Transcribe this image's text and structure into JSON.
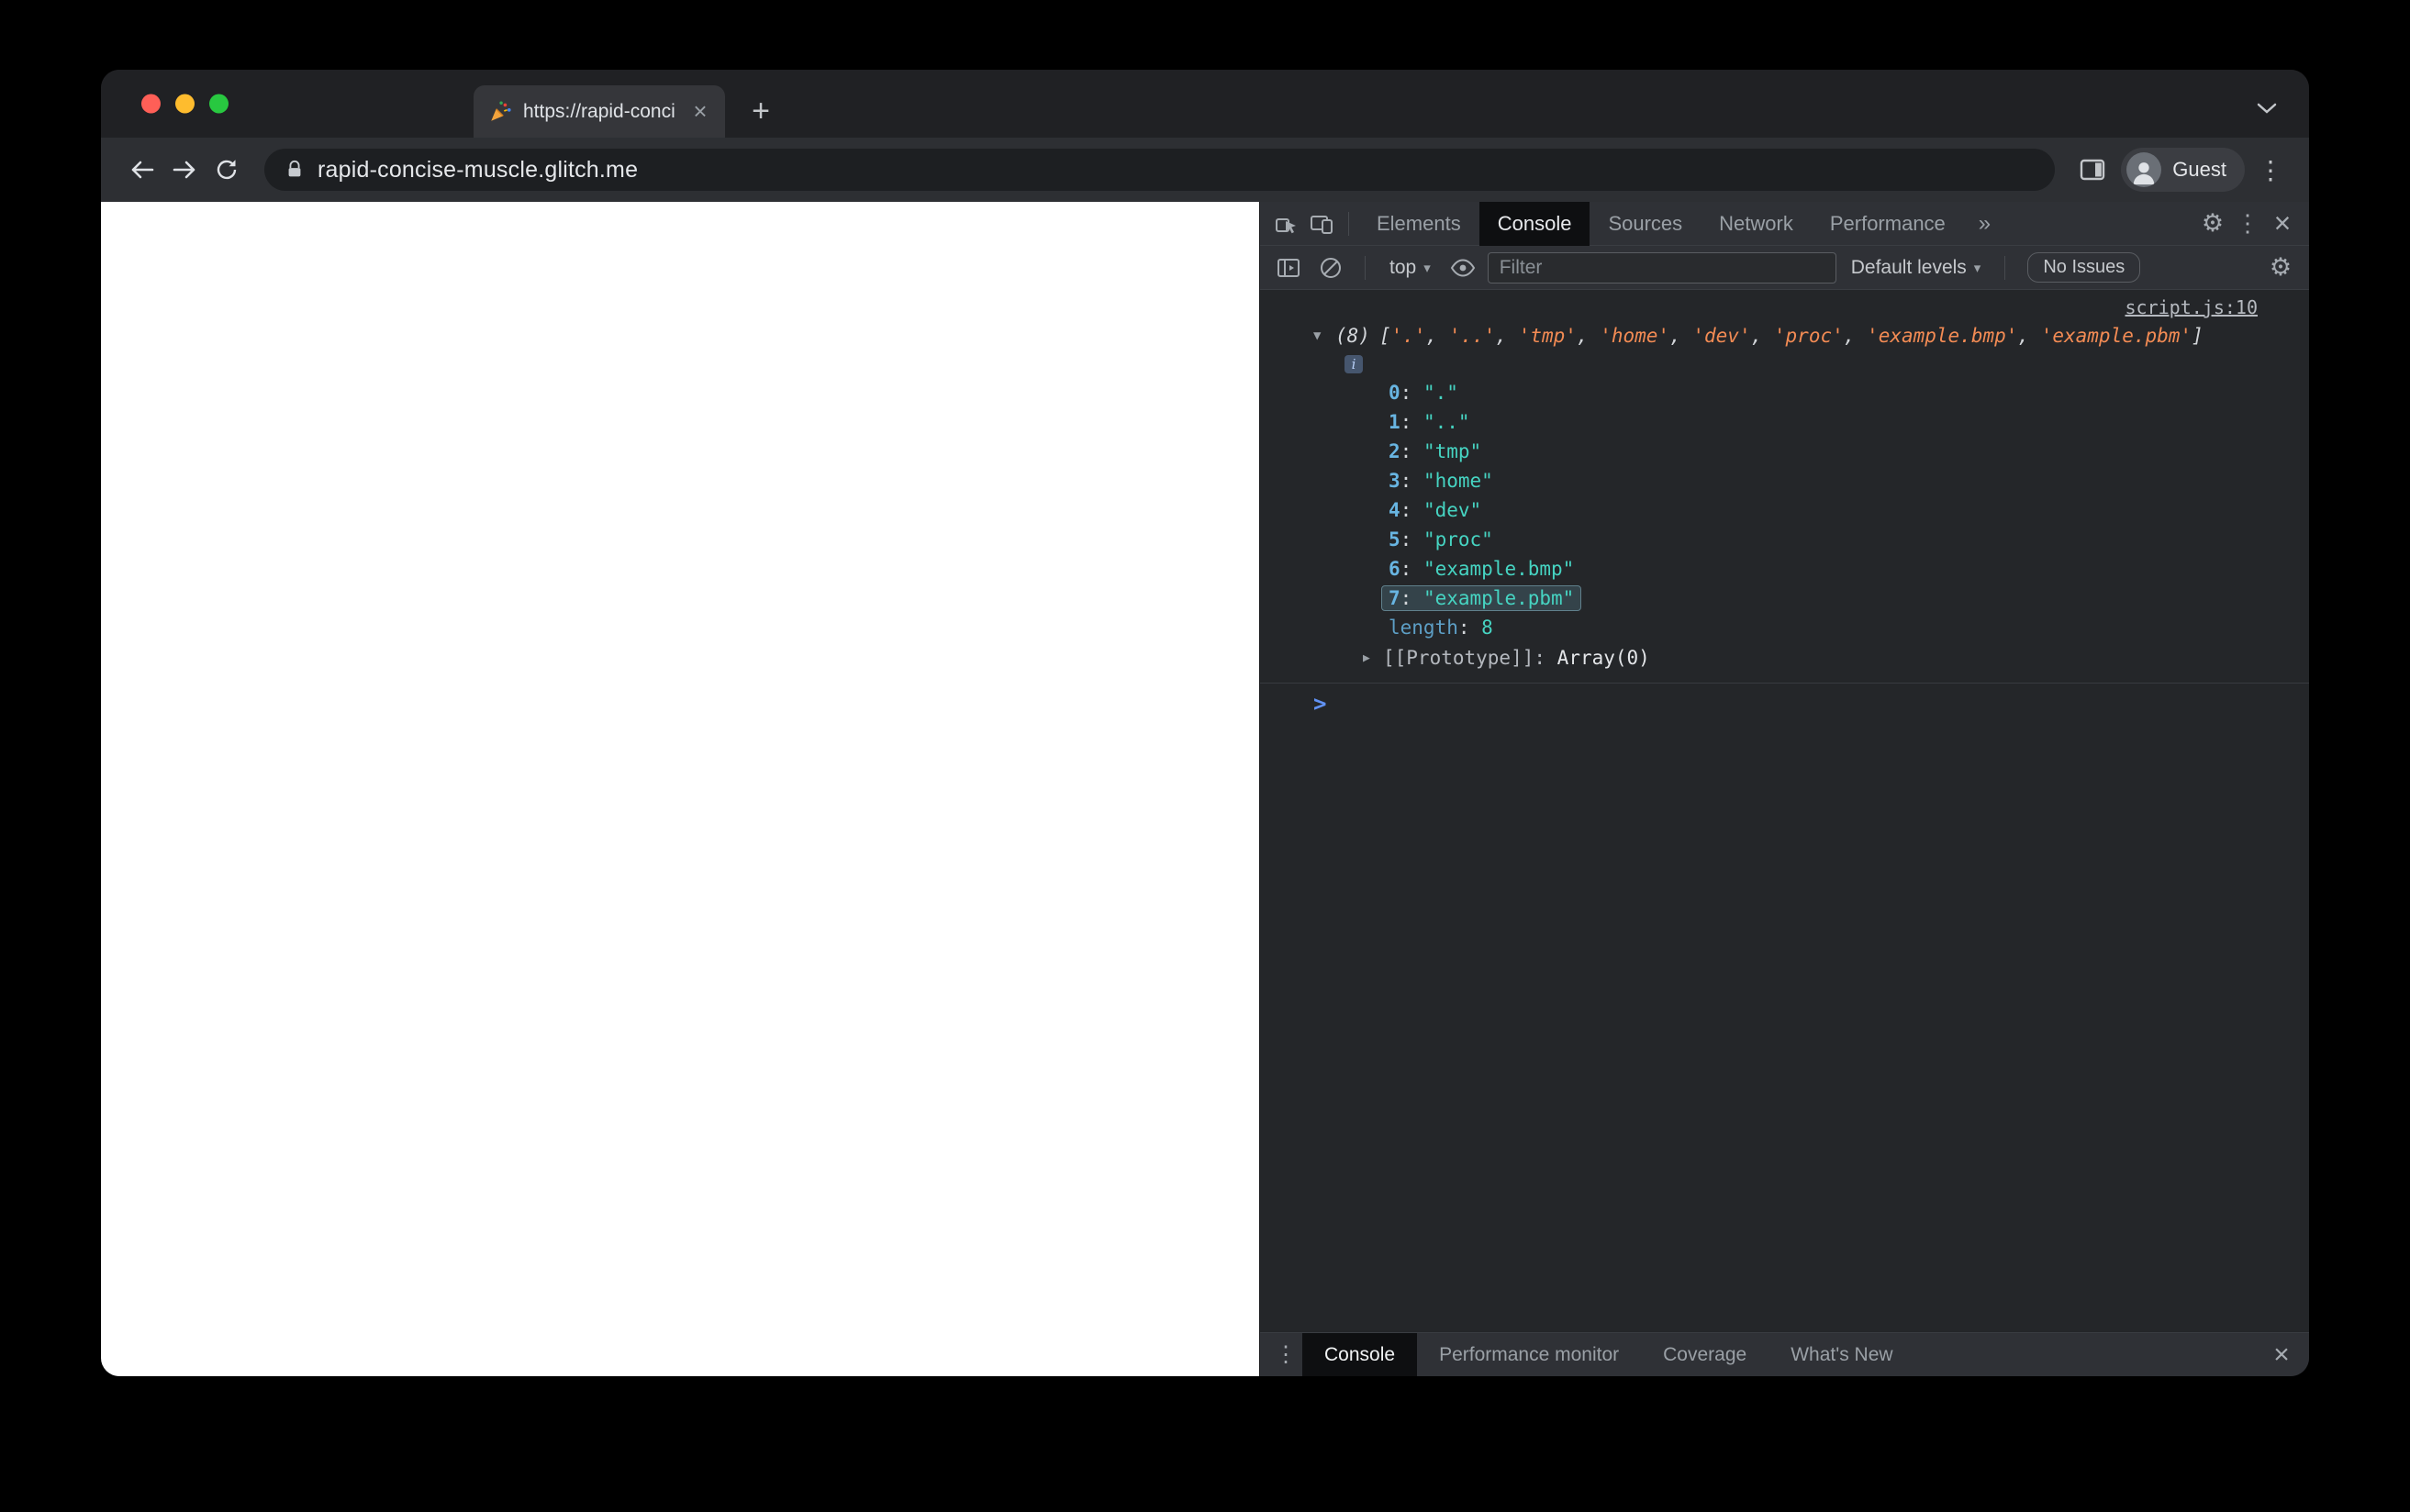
{
  "browser": {
    "tab_title": "https://rapid-concise-muscle.g",
    "url": "rapid-concise-muscle.glitch.me",
    "profile_label": "Guest",
    "favicon_name": "party-popper"
  },
  "icons": {
    "gear": "⚙",
    "kebab": "⋮",
    "close": "×",
    "caret_down": "▾",
    "triangle_expanded": "▼",
    "triangle_collapsed": "▶",
    "new_tab": "+",
    "info": "i"
  },
  "devtools": {
    "tabs": [
      {
        "label": "Elements",
        "active": false
      },
      {
        "label": "Console",
        "active": true
      },
      {
        "label": "Sources",
        "active": false
      },
      {
        "label": "Network",
        "active": false
      },
      {
        "label": "Performance",
        "active": false
      }
    ],
    "more_tabs_label": "»",
    "toolbar": {
      "context_label": "top",
      "filter_placeholder": "Filter",
      "levels_label": "Default levels",
      "issues_label": "No Issues"
    },
    "console": {
      "source_link": "script.js:10",
      "array_count": "(8)",
      "preview_items": [
        ".",
        "..",
        "tmp",
        "home",
        "dev",
        "proc",
        "example.bmp",
        "example.pbm"
      ],
      "properties": [
        {
          "key": "0",
          "value": ".",
          "type": "string",
          "highlighted": false
        },
        {
          "key": "1",
          "value": "..",
          "type": "string",
          "highlighted": false
        },
        {
          "key": "2",
          "value": "tmp",
          "type": "string",
          "highlighted": false
        },
        {
          "key": "3",
          "value": "home",
          "type": "string",
          "highlighted": false
        },
        {
          "key": "4",
          "value": "dev",
          "type": "string",
          "highlighted": false
        },
        {
          "key": "5",
          "value": "proc",
          "type": "string",
          "highlighted": false
        },
        {
          "key": "6",
          "value": "example.bmp",
          "type": "string",
          "highlighted": false
        },
        {
          "key": "7",
          "value": "example.pbm",
          "type": "string",
          "highlighted": true
        },
        {
          "key": "length",
          "value": "8",
          "type": "number",
          "highlighted": false
        }
      ],
      "prototype_label": "[[Prototype]]",
      "prototype_value": "Array(0)",
      "prompt": ">"
    },
    "drawer": {
      "tabs": [
        {
          "label": "Console",
          "active": true
        },
        {
          "label": "Performance monitor",
          "active": false
        },
        {
          "label": "Coverage",
          "active": false
        },
        {
          "label": "What's New",
          "active": false
        }
      ]
    }
  },
  "colors": {
    "mac_red": "#ff5f57",
    "mac_yellow": "#febc2e",
    "mac_green": "#28c840",
    "key": "#68b5e2",
    "string": "#46d4c2",
    "number": "#46d4c2",
    "preview_string": "#f28b54",
    "accent_blue": "#6192f5"
  }
}
